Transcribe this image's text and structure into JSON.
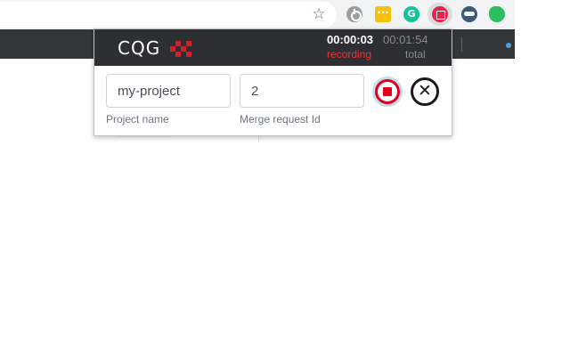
{
  "browser": {
    "star_icon": "star-icon",
    "extensions": [
      "power-icon",
      "notes-icon",
      "grammarly-icon",
      "record-icon",
      "spy-icon",
      "evernote-icon"
    ],
    "grammarly_glyph": "G",
    "star_glyph": "☆"
  },
  "popup": {
    "logo_text": "CQG",
    "recording": {
      "time": "00:00:03",
      "label": "recording"
    },
    "total": {
      "time": "00:01:54",
      "label": "total"
    },
    "project": {
      "value": "my-project",
      "caption": "Project name"
    },
    "merge_request": {
      "value": "2",
      "caption": "Merge request Id"
    },
    "close_glyph": "✕"
  },
  "colors": {
    "header_bg": "#2d2f33",
    "recording_red": "#ff2b2b",
    "stop_red": "#e0001a",
    "brand_red": "#d21f2a"
  }
}
